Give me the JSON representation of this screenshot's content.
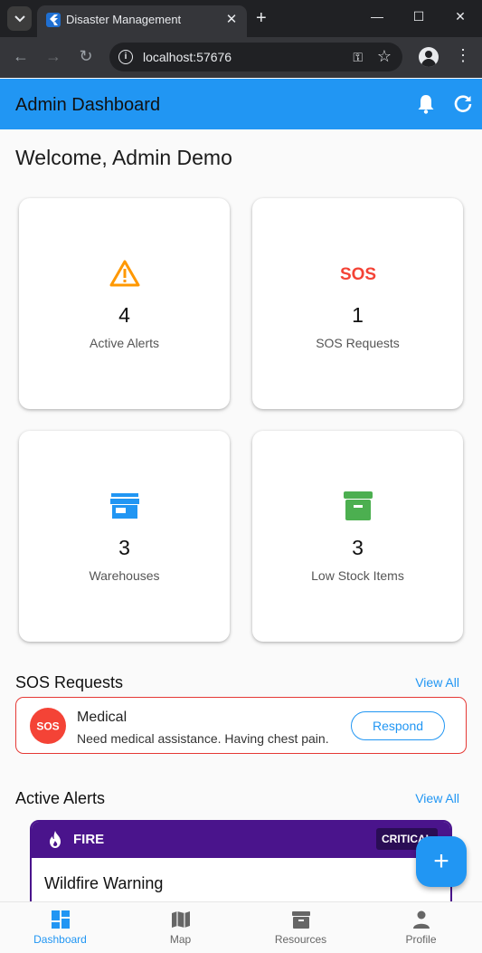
{
  "browser": {
    "tab_title": "Disaster Management",
    "url": "localhost:57676"
  },
  "app": {
    "title": "Admin Dashboard",
    "welcome": "Welcome, Admin Demo"
  },
  "stats": [
    {
      "icon": "warning-icon",
      "value": "4",
      "label": "Active Alerts",
      "color": "#ff9800"
    },
    {
      "icon": "sos-icon",
      "value": "1",
      "label": "SOS Requests",
      "color": "#f44336"
    },
    {
      "icon": "store-icon",
      "value": "3",
      "label": "Warehouses",
      "color": "#2196f3"
    },
    {
      "icon": "inventory-icon",
      "value": "3",
      "label": "Low Stock Items",
      "color": "#4caf50"
    }
  ],
  "sos_section": {
    "title": "SOS Requests",
    "view_all": "View All",
    "items": [
      {
        "avatar_text": "SOS",
        "type": "Medical",
        "description": "Need medical assistance. Having chest pain.",
        "action": "Respond"
      }
    ]
  },
  "alerts_section": {
    "title": "Active Alerts",
    "view_all": "View All",
    "items": [
      {
        "type": "FIRE",
        "severity": "CRITICAL",
        "title": "Wildfire Warning",
        "color": "#4a148c"
      }
    ]
  },
  "fab": {
    "label": "+"
  },
  "bottom_nav": [
    {
      "label": "Dashboard",
      "icon": "dashboard-icon",
      "active": true
    },
    {
      "label": "Map",
      "icon": "map-icon",
      "active": false
    },
    {
      "label": "Resources",
      "icon": "archive-icon",
      "active": false
    },
    {
      "label": "Profile",
      "icon": "person-icon",
      "active": false
    }
  ],
  "colors": {
    "primary": "#2196f3",
    "danger": "#f44336",
    "alert": "#4a148c"
  }
}
